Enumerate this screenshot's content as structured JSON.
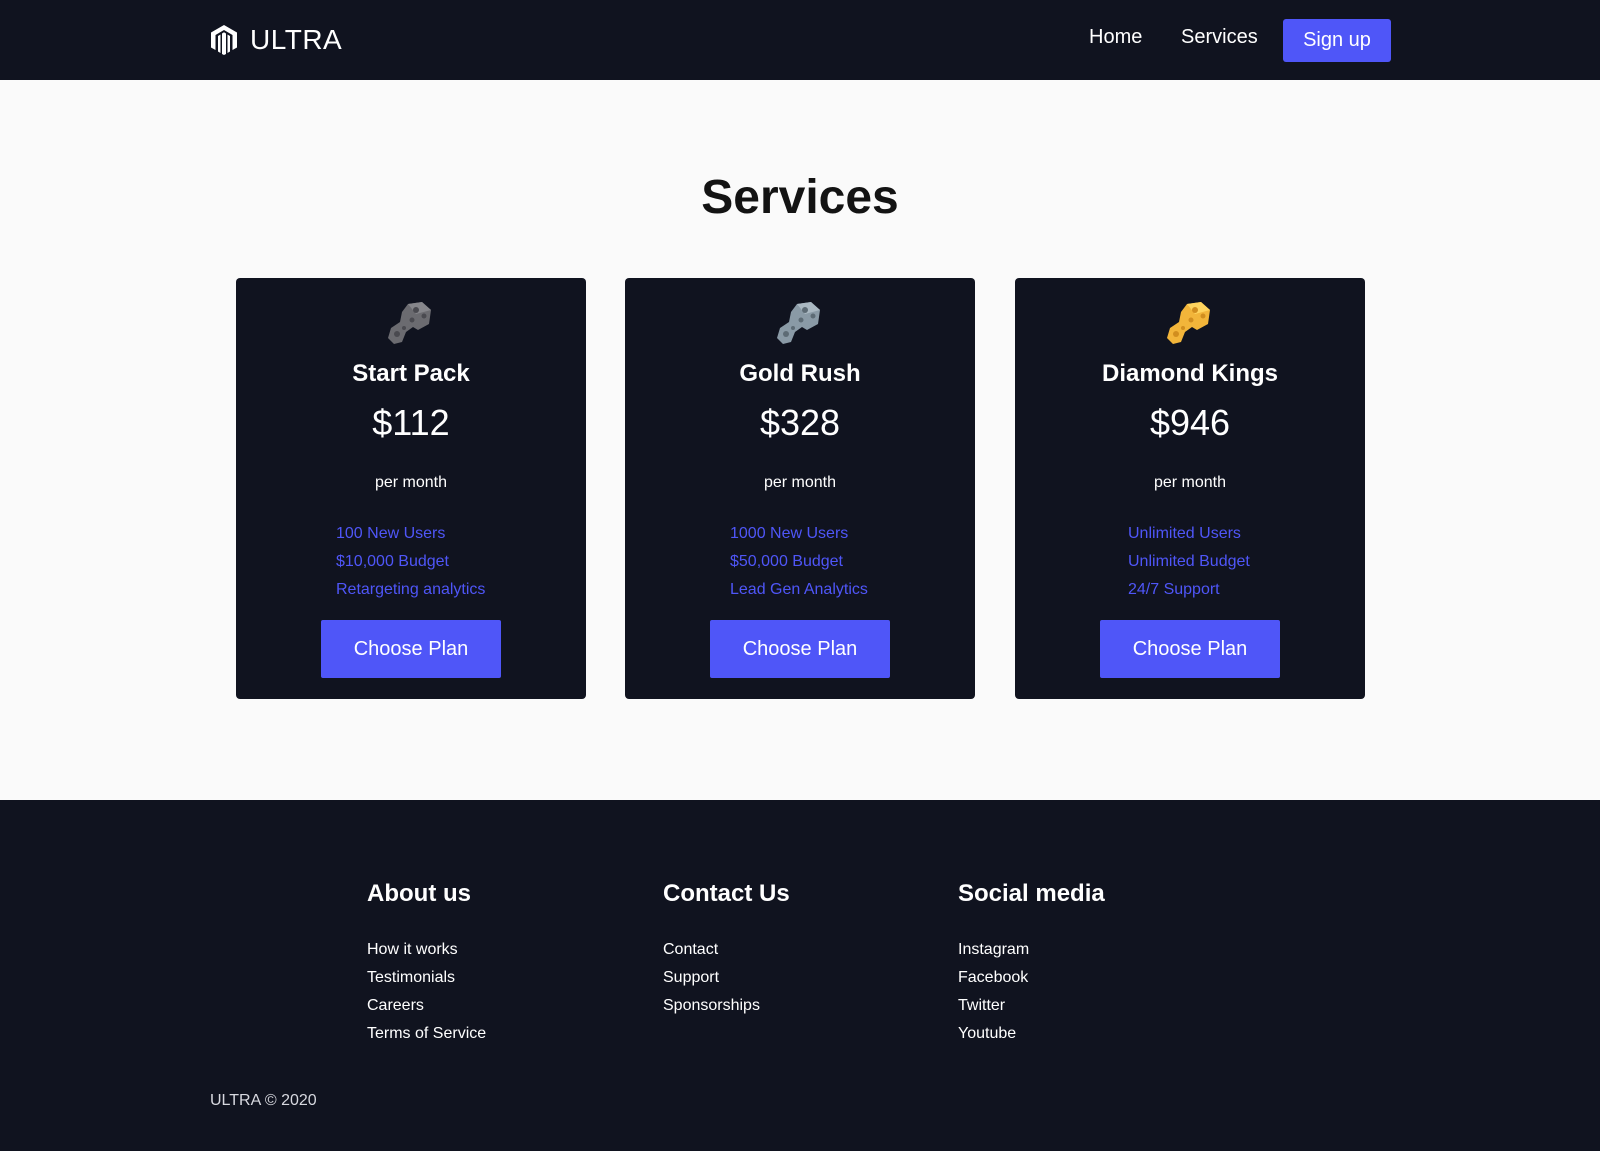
{
  "nav": {
    "brand": "ULTRA",
    "brand_icon": "magento-hex-icon",
    "links": [
      "Home",
      "Services"
    ],
    "signup": "Sign up"
  },
  "services": {
    "title": "Services",
    "plans": [
      {
        "name": "Start Pack",
        "price": "$112",
        "period": "per month",
        "icon": "rock-icon",
        "icon_color": "#6b6b70",
        "features": [
          "100 New Users",
          "$10,000 Budget",
          "Retargeting analytics"
        ],
        "button": "Choose Plan"
      },
      {
        "name": "Gold Rush",
        "price": "$328",
        "period": "per month",
        "icon": "silver-ore-icon",
        "icon_color": "#8a9aa6",
        "features": [
          "1000 New Users",
          "$50,000 Budget",
          "Lead Gen Analytics"
        ],
        "button": "Choose Plan"
      },
      {
        "name": "Diamond Kings",
        "price": "$946",
        "period": "per month",
        "icon": "gold-nugget-icon",
        "icon_color": "#f2b53a",
        "features": [
          "Unlimited Users",
          "Unlimited Budget",
          "24/7 Support"
        ],
        "button": "Choose Plan"
      }
    ]
  },
  "footer": {
    "columns": [
      {
        "heading": "About us",
        "links": [
          "How it works",
          "Testimonials",
          "Careers",
          "Terms of Service"
        ]
      },
      {
        "heading": "Contact Us",
        "links": [
          "Contact",
          "Support",
          "Sponsorships"
        ]
      },
      {
        "heading": "Social media",
        "links": [
          "Instagram",
          "Facebook",
          "Twitter",
          "Youtube"
        ]
      }
    ],
    "copyright": "ULTRA © 2020"
  },
  "colors": {
    "dark": "#10131f",
    "accent": "#4f56f8",
    "page_bg": "#fafafa"
  }
}
